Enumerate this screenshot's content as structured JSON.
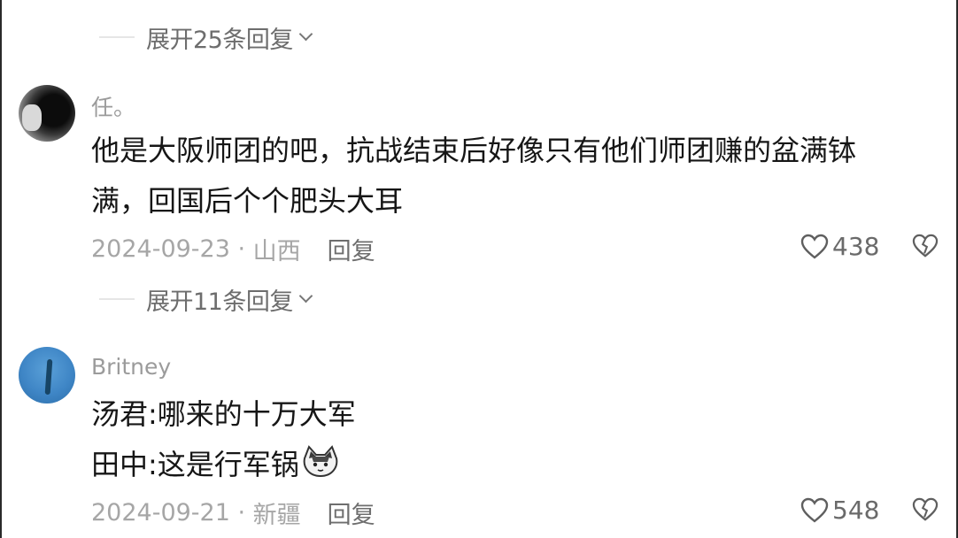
{
  "thread": {
    "expand_top": "展开25条回复",
    "comments": [
      {
        "username": "任。",
        "lines": [
          "他是大阪师团的吧，抗战结束后好像只有他们师团赚的盆满钵",
          "满，回国后个个肥头大耳"
        ],
        "date": "2024-09-23",
        "location": "山西",
        "reply_label": "回复",
        "likes": "438",
        "expand_label": "展开11条回复"
      },
      {
        "username": "Britney",
        "lines": [
          "汤君:哪来的十万大军",
          "田中:这是行军锅"
        ],
        "emoji": "cat-emoji",
        "date": "2024-09-21",
        "location": "新疆",
        "reply_label": "回复",
        "likes": "548"
      }
    ]
  },
  "icons": {
    "like": "heart-outline-icon",
    "dislike": "broken-heart-icon",
    "expand": "chevron-down-icon"
  },
  "colors": {
    "text_primary": "#161616",
    "text_secondary": "#9b9b9b",
    "meta": "#a6a6a6",
    "britney_avatar": "#3f86c6"
  }
}
